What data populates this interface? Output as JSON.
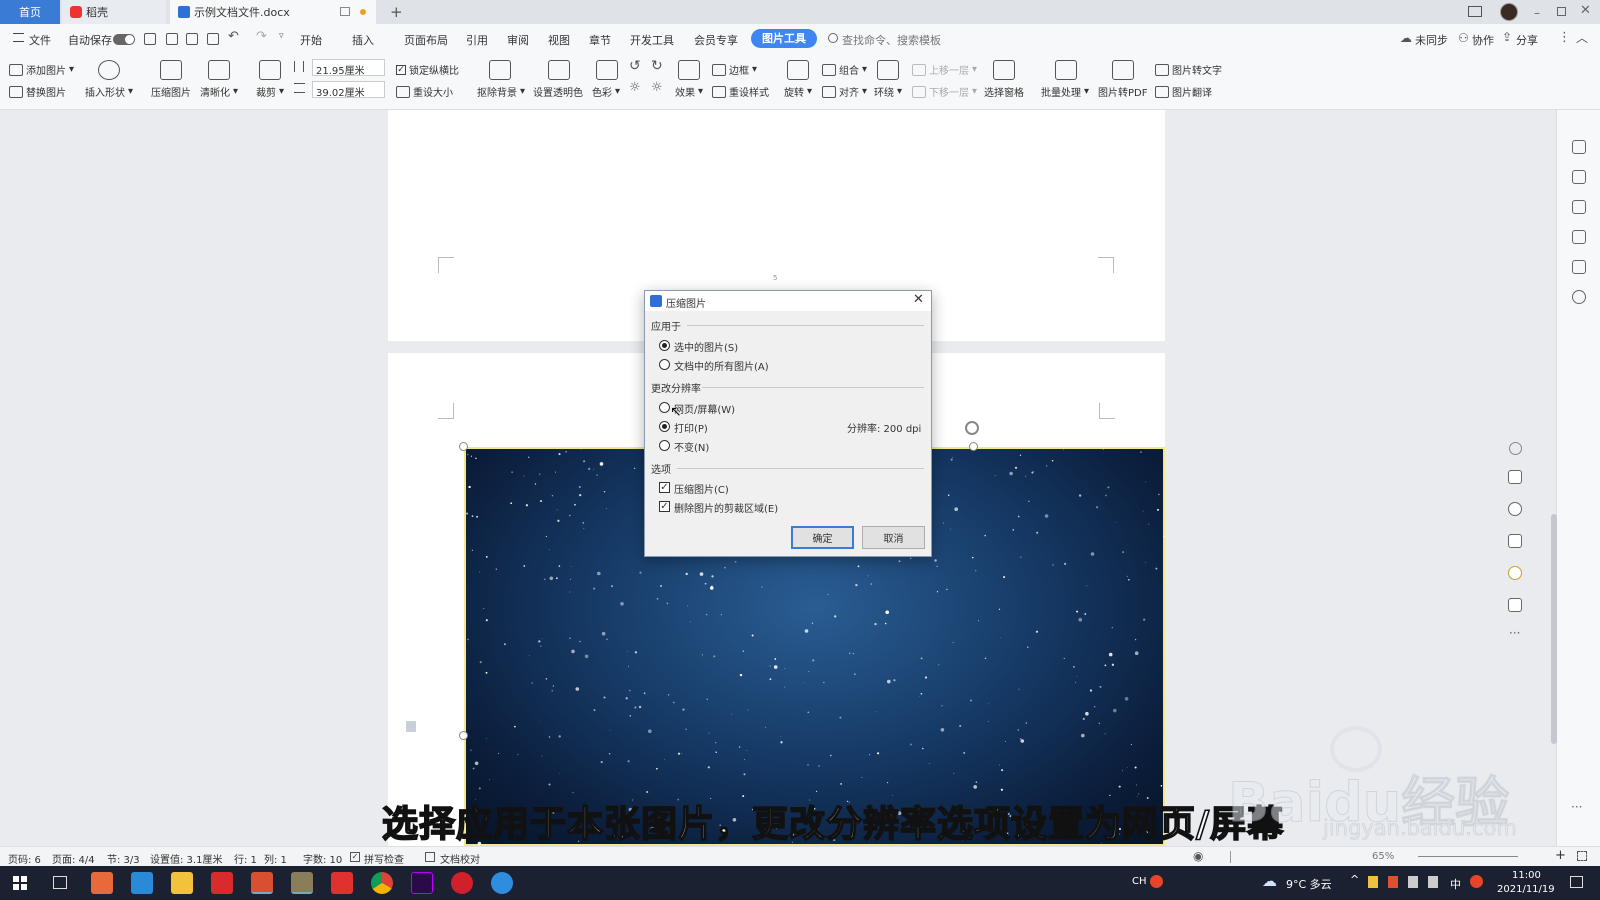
{
  "tabs": {
    "home": "首页",
    "daoke": "稻壳",
    "doc": "示例文档文件.docx",
    "add": "+"
  },
  "menu": {
    "file": "文件",
    "autosave": "自动保存",
    "items": [
      "开始",
      "插入",
      "页面布局",
      "引用",
      "审阅",
      "视图",
      "章节",
      "开发工具",
      "会员专享"
    ],
    "active": "图片工具",
    "search": "查找命令、搜索模板",
    "sync": "未同步",
    "collab": "协作",
    "share": "分享"
  },
  "ribbon": {
    "add_pic": "添加图片",
    "replace_pic": "替换图片",
    "insert_shape": "插入形状",
    "compress": "压缩图片",
    "sharpen": "清晰化",
    "crop": "裁剪",
    "width": "21.95厘米",
    "height": "39.02厘米",
    "lock_ratio": "锁定纵横比",
    "reset_size": "重设大小",
    "remove_bg": "抠除背景",
    "set_transparent": "设置透明色",
    "color": "色彩",
    "effect": "效果",
    "border": "边框",
    "reset_style": "重设样式",
    "rotate": "旋转",
    "group": "组合",
    "align": "对齐",
    "wrap": "环绕",
    "bring_up": "上移一层",
    "send_down": "下移一层",
    "select_pane": "选择窗格",
    "batch": "批量处理",
    "to_pdf": "图片转PDF",
    "to_text": "图片转文字",
    "translate": "图片翻译"
  },
  "doc": {
    "page_num": "5"
  },
  "dialog": {
    "title": "压缩图片",
    "apply_label": "应用于",
    "apply_selected": "选中的图片(S)",
    "apply_all": "文档中的所有图片(A)",
    "resolution_label": "更改分辨率",
    "res_web": "网页/屏幕(W)",
    "res_print": "打印(P)",
    "res_none": "不变(N)",
    "dpi": "分辨率:  200 dpi",
    "options_label": "选项",
    "opt_compress": "压缩图片(C)",
    "opt_delete_crop": "删除图片的剪裁区域(E)",
    "ok": "确定",
    "cancel": "取消"
  },
  "subtitle": "选择应用于本张图片，更改分辨率选项设置为网页/屏幕",
  "watermark": {
    "brand": "Baidu经验",
    "url": "jingyan.baidu.com"
  },
  "status": {
    "page": "页码: 6",
    "pages": "页面: 4/4",
    "section": "节: 3/3",
    "setting": "设置值: 3.1厘米",
    "row": "行: 1",
    "col": "列: 1",
    "words": "字数: 10",
    "spell": "拼写检查",
    "proof": "文档校对",
    "zoom": "65%"
  },
  "taskbar": {
    "ime": "CH",
    "weather": "9°C 多云",
    "lang": "中",
    "time": "11:00",
    "date": "2021/11/19"
  }
}
